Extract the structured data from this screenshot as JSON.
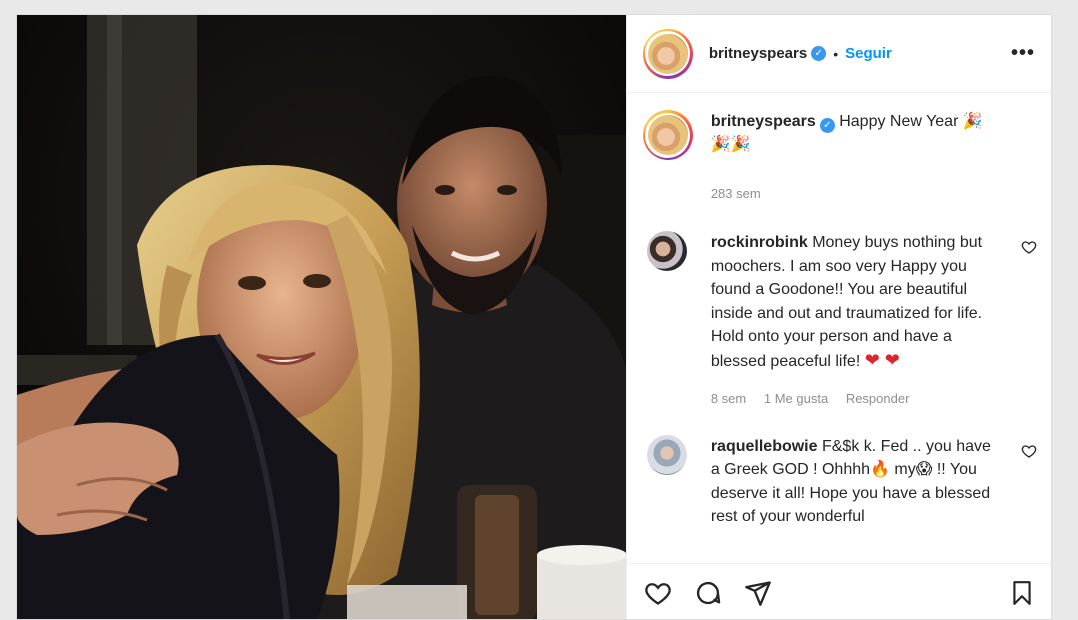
{
  "post": {
    "author": "britneyspears",
    "follow_label": "Seguir",
    "more_label": "•••",
    "separator": "•"
  },
  "caption": {
    "username": "britneyspears",
    "text": "Happy New Year 🎉\n🎉🎉",
    "time": "283 sem"
  },
  "comments": [
    {
      "username": "rockinrobink",
      "text": "Money buys nothing but moochers. I am soo very Happy you found a Goodone!! You are beautiful inside and out and traumatized for life. Hold onto your person and have a blessed peaceful life!",
      "emoji": "❤ ❤",
      "time": "8 sem",
      "likes": "1 Me gusta",
      "reply_label": "Responder"
    },
    {
      "username": "raquellebowie",
      "text": "F&$k k. Fed .. you have a Greek GOD ! Ohhhh🔥 my😱 !! You deserve it all! Hope you have a blessed rest of your wonderful"
    }
  ],
  "actions": {
    "like": "heart-icon",
    "comment": "comment-icon",
    "share": "share-icon",
    "save": "bookmark-icon"
  }
}
